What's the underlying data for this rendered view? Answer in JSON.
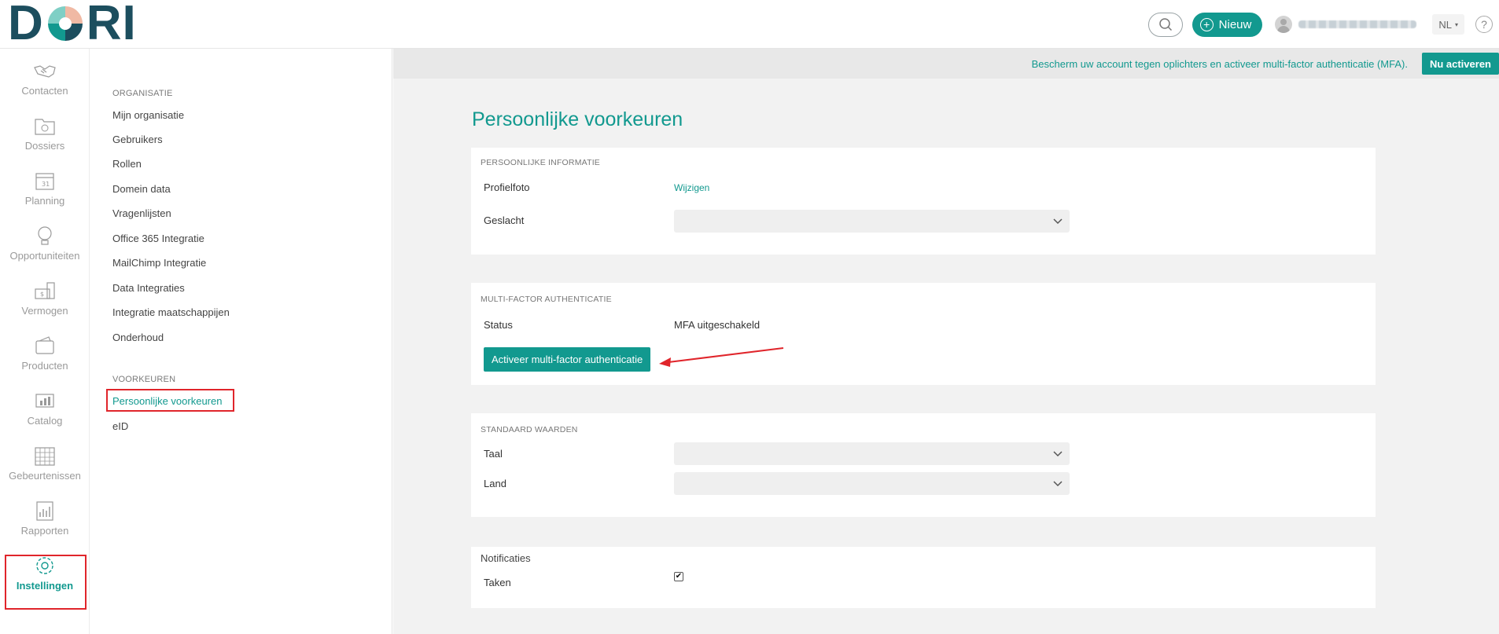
{
  "brand": {
    "logo_text": "DORI",
    "accent": "#12998f",
    "dark": "#1c4e5e",
    "highlight": "#e0252b"
  },
  "header": {
    "search_icon": "search-icon",
    "new_label": "Nieuw",
    "language": "NL",
    "help_label": "?"
  },
  "rail": {
    "items": [
      {
        "label": "Contacten",
        "icon": "handshake-icon"
      },
      {
        "label": "Dossiers",
        "icon": "folder-icon"
      },
      {
        "label": "Planning",
        "icon": "calendar-icon"
      },
      {
        "label": "Opportuniteiten",
        "icon": "lightbulb-icon"
      },
      {
        "label": "Vermogen",
        "icon": "money-icon"
      },
      {
        "label": "Producten",
        "icon": "wallet-icon"
      },
      {
        "label": "Catalog",
        "icon": "chart-icon"
      },
      {
        "label": "Gebeurtenissen",
        "icon": "grid-calendar-icon"
      },
      {
        "label": "Rapporten",
        "icon": "report-icon"
      },
      {
        "label": "Instellingen",
        "icon": "gear-icon"
      }
    ]
  },
  "settings_menu": {
    "organisatie_header": "ORGANISATIE",
    "organisatie_items": [
      "Mijn organisatie",
      "Gebruikers",
      "Rollen",
      "Domein data",
      "Vragenlijsten",
      "Office 365 Integratie",
      "MailChimp Integratie",
      "Data Integraties",
      "Integratie maatschappijen",
      "Onderhoud"
    ],
    "voorkeuren_header": "VOORKEUREN",
    "voorkeuren_items": [
      "Persoonlijke voorkeuren",
      "eID"
    ]
  },
  "banner": {
    "text": "Bescherm uw account tegen oplichters en activeer multi-factor authenticatie (MFA).",
    "button": "Nu activeren"
  },
  "page": {
    "title": "Persoonlijke voorkeuren",
    "personal": {
      "header": "PERSOONLIJKE INFORMATIE",
      "photo_label": "Profielfoto",
      "photo_link": "Wijzigen",
      "gender_label": "Geslacht"
    },
    "mfa": {
      "header": "MULTI-FACTOR AUTHENTICATIE",
      "status_label": "Status",
      "status_value": "MFA uitgeschakeld",
      "activate_button": "Activeer multi-factor authenticatie"
    },
    "defaults": {
      "header": "STANDAARD WAARDEN",
      "language_label": "Taal",
      "country_label": "Land"
    },
    "notifications": {
      "header": "Notificaties",
      "tasks_label": "Taken",
      "tasks_checked": true,
      "check_mark": "✔"
    }
  }
}
